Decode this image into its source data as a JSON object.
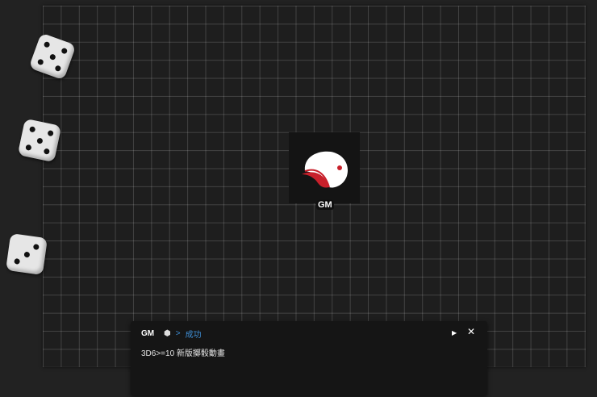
{
  "token": {
    "label": "GM"
  },
  "message": {
    "sender": "GM",
    "arrow": ">",
    "status": "成功",
    "text": "3D6>=10 新版擲骰動畫"
  },
  "dice": [
    5,
    5,
    3
  ],
  "colors": {
    "accent": "#3f8fd6",
    "token_red": "#c8202b"
  }
}
